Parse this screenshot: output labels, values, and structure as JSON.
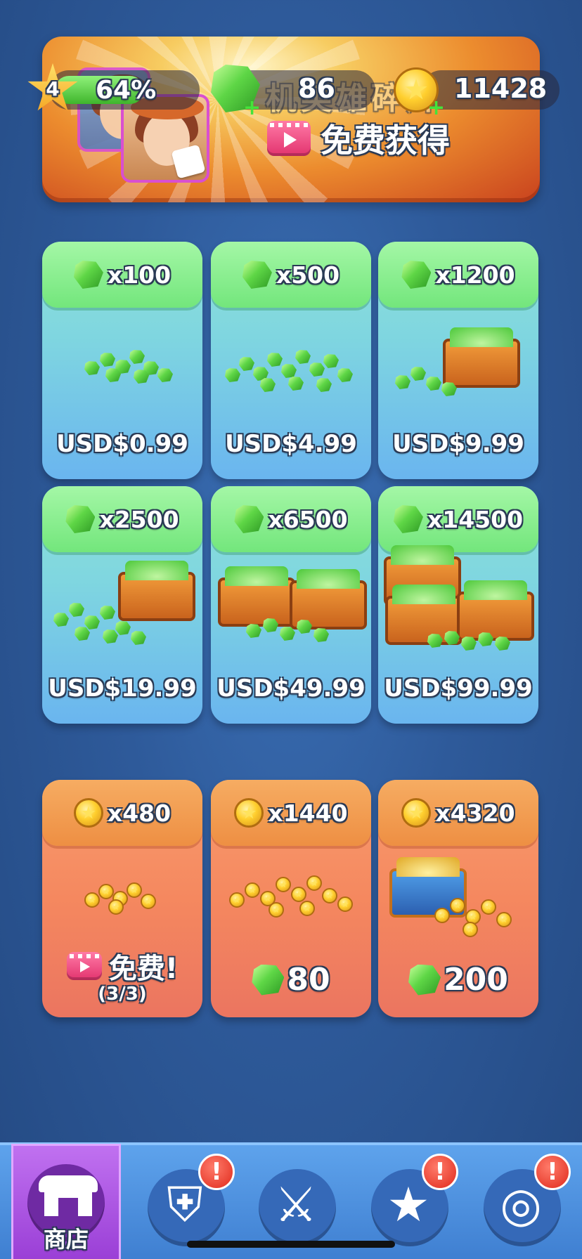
{
  "hud": {
    "level": "4",
    "level_progress_text": "64%",
    "level_progress": 0.64,
    "gems": "86",
    "coins": "11428"
  },
  "banner": {
    "title": "机英雄碎片",
    "free_label": "免费获得"
  },
  "gem_packs": [
    {
      "qty": "x100",
      "price": "USD$0.99"
    },
    {
      "qty": "x500",
      "price": "USD$4.99"
    },
    {
      "qty": "x1200",
      "price": "USD$9.99"
    },
    {
      "qty": "x2500",
      "price": "USD$19.99"
    },
    {
      "qty": "x6500",
      "price": "USD$49.99"
    },
    {
      "qty": "x14500",
      "price": "USD$99.99"
    }
  ],
  "coin_packs": [
    {
      "qty": "x480",
      "free_label": "免费!",
      "free_count": "(3/3)"
    },
    {
      "qty": "x1440",
      "gem_cost": "80"
    },
    {
      "qty": "x4320",
      "gem_cost": "200"
    }
  ],
  "nav": {
    "shop_label": "商店",
    "badge": "!"
  },
  "icons": [
    "star-icon",
    "gem-icon",
    "coin-icon",
    "video-icon",
    "puzzle-icon",
    "shop-icon",
    "shield-icon",
    "crossed-swords-icon",
    "star-icon",
    "target-icon"
  ],
  "colors": {
    "gem_card_header": "#73e67c",
    "coin_card_header": "#ee8f43",
    "nav_active": "#9a3fd6",
    "background": "#2e5a9a"
  }
}
